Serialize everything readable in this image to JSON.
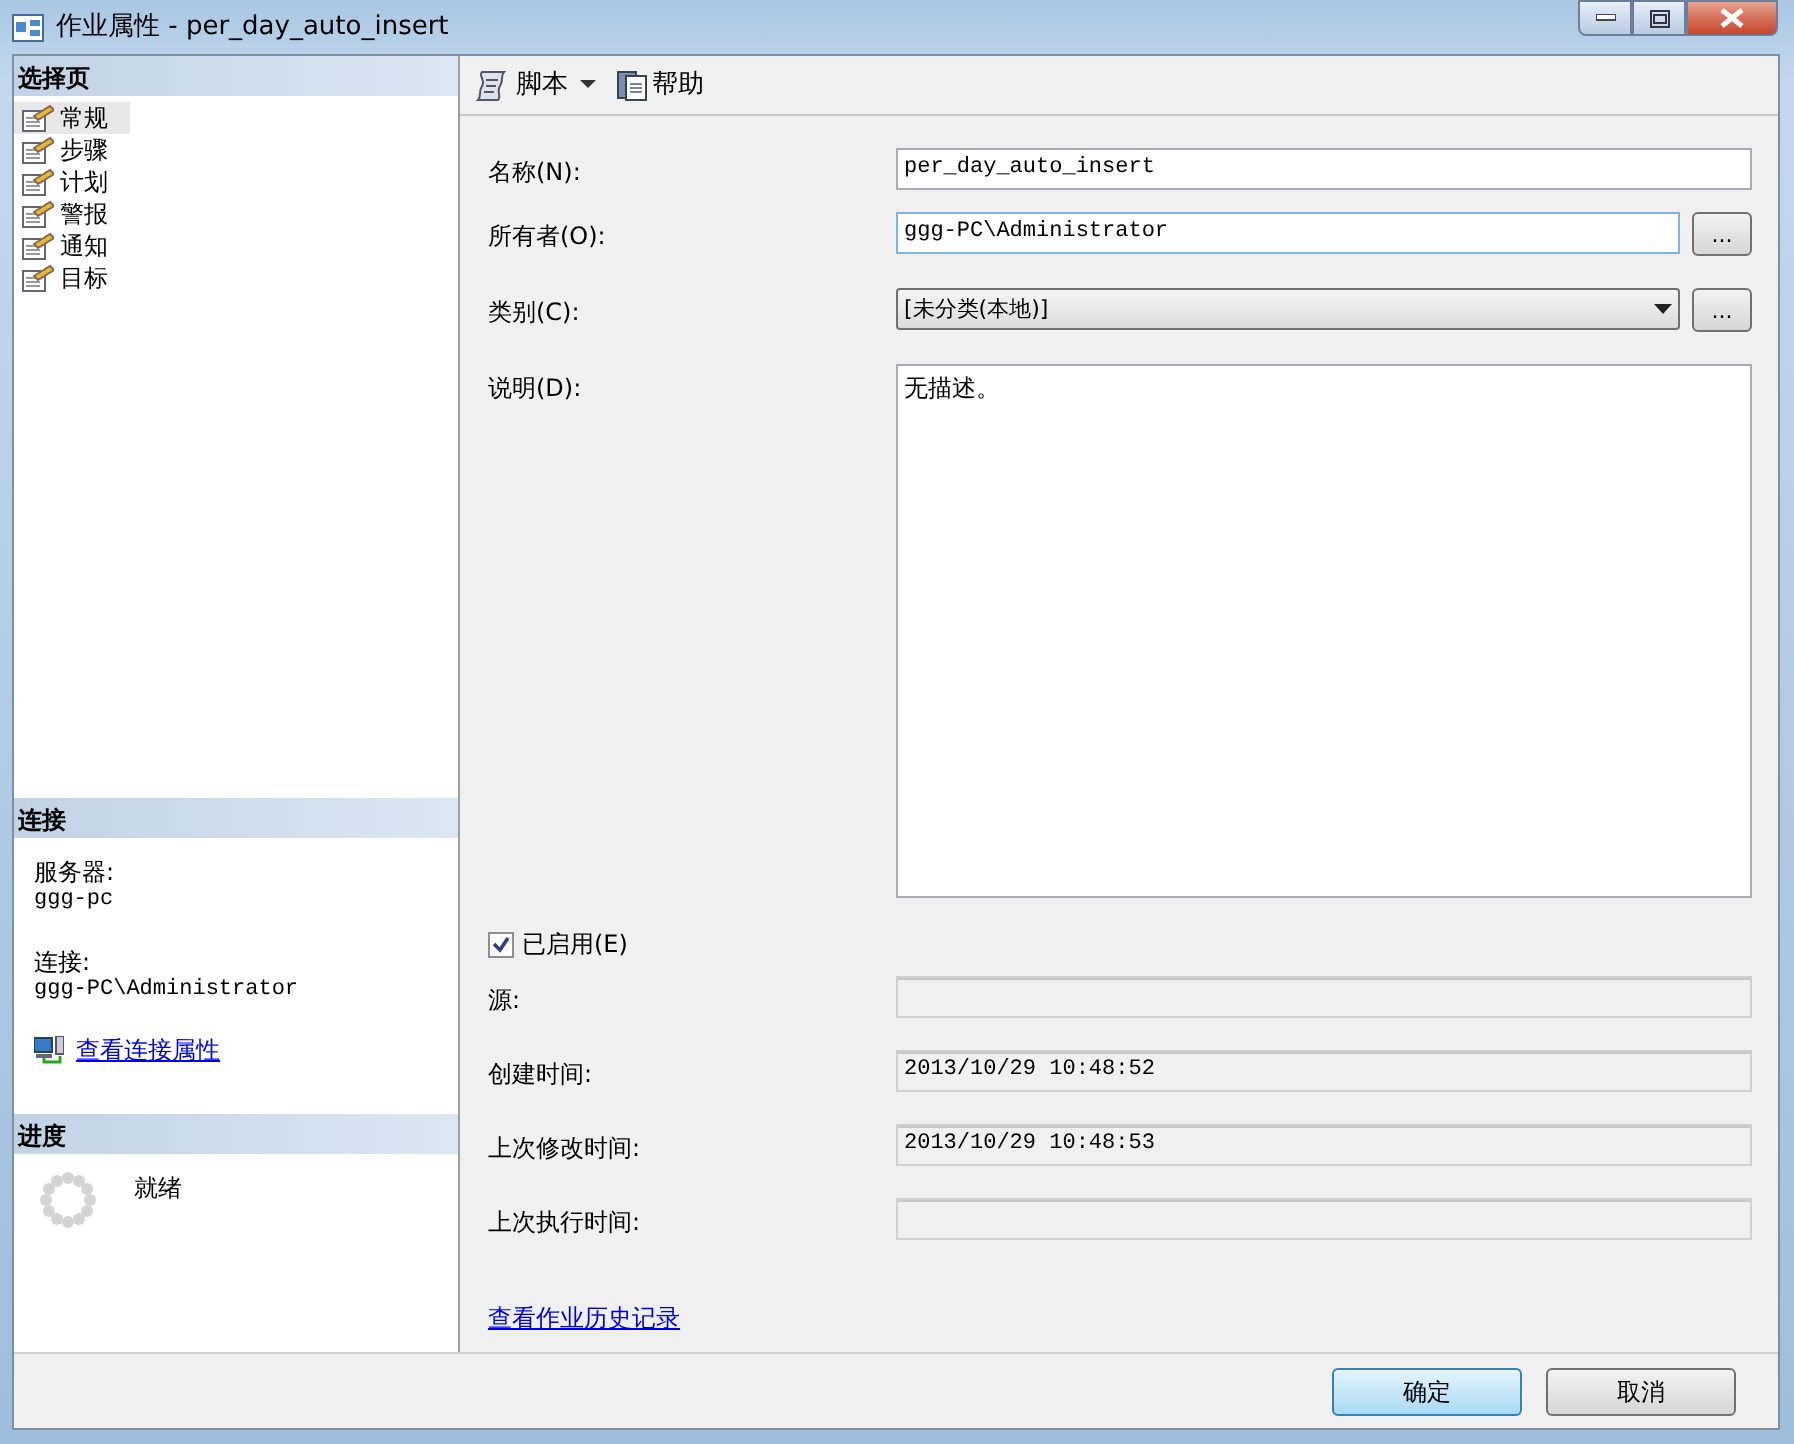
{
  "window": {
    "title": "作业属性 - per_day_auto_insert"
  },
  "sidebar": {
    "header": "选择页",
    "pages": [
      {
        "label": "常规",
        "selected": true
      },
      {
        "label": "步骤",
        "selected": false
      },
      {
        "label": "计划",
        "selected": false
      },
      {
        "label": "警报",
        "selected": false
      },
      {
        "label": "通知",
        "selected": false
      },
      {
        "label": "目标",
        "selected": false
      }
    ]
  },
  "connection": {
    "header": "连接",
    "server_label": "服务器:",
    "server": "ggg-pc",
    "connection_label": "连接:",
    "connection": "ggg-PC\\Administrator",
    "link": "查看连接属性"
  },
  "progress": {
    "header": "进度",
    "status": "就绪"
  },
  "toolbar": {
    "script": "脚本",
    "help": "帮助"
  },
  "fields": [
    {
      "kind": "text",
      "label": "名称(N):",
      "value": "per_day_auto_insert"
    },
    {
      "kind": "browse",
      "label": "所有者(O):",
      "value": "ggg-PC\\Administrator",
      "button": "..."
    },
    {
      "kind": "dropdown",
      "label": "类别(C):",
      "value": "[未分类(本地)]",
      "button": "..."
    },
    {
      "kind": "textarea",
      "label": "说明(D):",
      "value": "无描述。"
    }
  ],
  "enabled": {
    "label": "已启用(E)",
    "checked": true
  },
  "info": [
    {
      "label": "源:"
    },
    {
      "label": "创建时间:",
      "value": "2013/10/29 10:48:52"
    },
    {
      "label": "上次修改时间:",
      "value": "2013/10/29 10:48:53"
    },
    {
      "label": "上次执行时间:"
    }
  ],
  "history_link": "查看作业历史记录",
  "buttons": [
    {
      "label": "确定",
      "default": true
    },
    {
      "label": "取消",
      "default": false
    }
  ]
}
